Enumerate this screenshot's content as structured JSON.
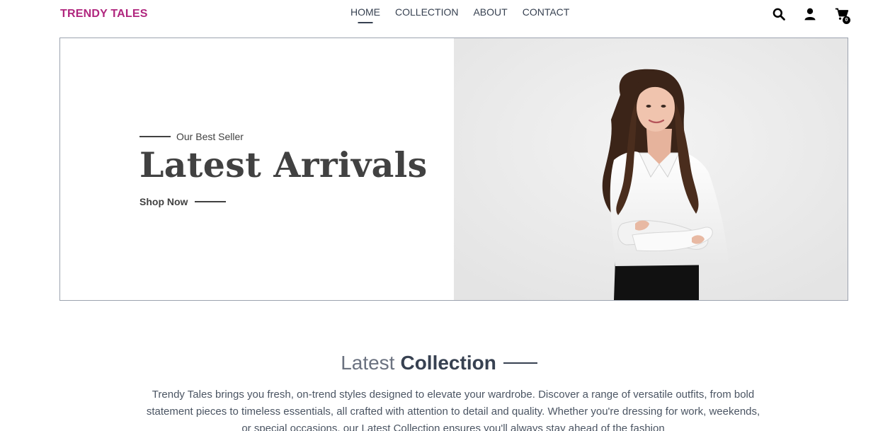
{
  "brand": {
    "name": "TRENDY TALES",
    "color": "#b0267e"
  },
  "nav": {
    "items": [
      {
        "label": "HOME",
        "active": true
      },
      {
        "label": "COLLECTION",
        "active": false
      },
      {
        "label": "ABOUT",
        "active": false
      },
      {
        "label": "CONTACT",
        "active": false
      }
    ]
  },
  "header_icons": {
    "search": "search-icon",
    "profile": "user-icon",
    "cart": "cart-icon",
    "cart_count": "0"
  },
  "hero": {
    "tagline": "Our Best Seller",
    "title": "Latest Arrivals",
    "cta": "Shop Now",
    "image": "woman in white shirt with crossed arms"
  },
  "collection": {
    "title_light": "Latest",
    "title_bold": "Collection",
    "description": "Trendy Tales brings you fresh, on-trend styles designed to elevate your wardrobe. Discover a range of versatile outfits, from bold statement pieces to timeless essentials, all crafted with attention to detail and quality. Whether you're dressing for work, weekends, or special occasions, our Latest Collection ensures you'll always stay ahead of the fashion"
  }
}
